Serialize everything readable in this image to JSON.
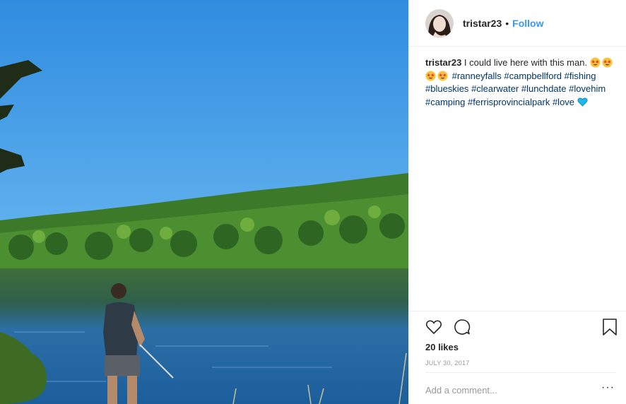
{
  "post": {
    "username": "tristar23",
    "separator": "•",
    "follow_label": "Follow",
    "caption": {
      "username": "tristar23",
      "text": " I could live here with this man.",
      "hashtags": [
        "#ranneyfalls",
        "#campbellford",
        "#fishing",
        "#blueskies",
        "#clearwater",
        "#lunchdate",
        "#lovehim",
        "#camping",
        "#ferrisprovincialpark",
        "#love"
      ]
    },
    "likes": "20 likes",
    "date": "July 30, 2017",
    "comment_placeholder": "Add a comment...",
    "more_label": "···"
  },
  "icons": {
    "like": "heart-icon",
    "comment": "comment-bubble-icon",
    "save": "bookmark-icon",
    "caption_emoji": "star-struck-face-emoji",
    "heart_emoji": "blue-heart-emoji"
  },
  "colors": {
    "follow": "#3897f0",
    "hashtag": "#003569",
    "secondary_text": "#999999",
    "sky": "#5aa9e6",
    "water": "#1f6fb0",
    "forest": "#3f7d2c"
  }
}
